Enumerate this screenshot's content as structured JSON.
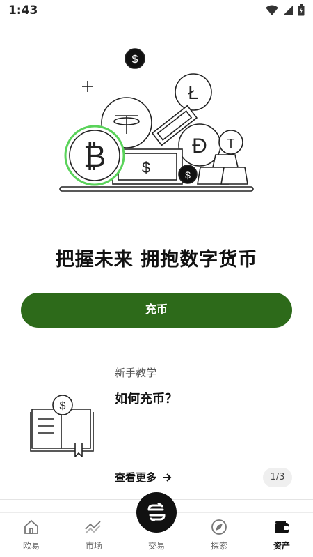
{
  "status_bar": {
    "time": "1:43"
  },
  "hero": {
    "headline": "把握未来 拥抱数字货币"
  },
  "deposit_button": {
    "label": "充币"
  },
  "tutorial": {
    "category": "新手教学",
    "title": "如何充币？",
    "more_label": "查看更多",
    "page_indicator": "1/3"
  },
  "bottom_nav": {
    "items": [
      {
        "label": "欧易",
        "icon": "home-icon"
      },
      {
        "label": "市场",
        "icon": "chart-icon"
      },
      {
        "label": "交易",
        "icon": "swap-icon"
      },
      {
        "label": "探索",
        "icon": "compass-icon"
      },
      {
        "label": "资产",
        "icon": "wallet-icon"
      }
    ],
    "active": "资产"
  },
  "colors": {
    "accent": "#2d6a1a",
    "highlight_ring": "#5ad35a"
  }
}
